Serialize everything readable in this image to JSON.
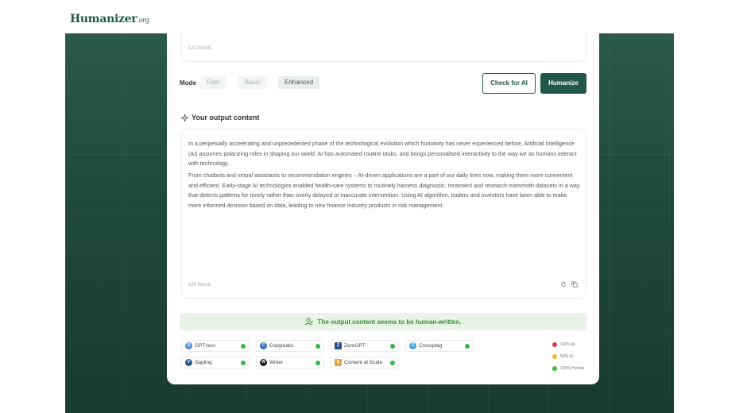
{
  "brand": {
    "name": "Humanizer",
    "suffix": ".org"
  },
  "input": {
    "word_count": "122 Words"
  },
  "mode": {
    "label": "Mode",
    "options": [
      "Fast",
      "Basic",
      "Enhanced"
    ],
    "selected": "Enhanced"
  },
  "actions": {
    "check_label": "Check for AI",
    "humanize_label": "Humanize"
  },
  "output": {
    "title": "Your output content",
    "paragraphs": [
      "In a perpetually accelerating and unprecedented phase of the technological evolution which humanity has never experienced before, Artificial Intelligence (AI) assumes polarizing roles in shaping our world. AI has automated routine tasks, and brings personalised interactivity to the way we as humans interact with technology.",
      "From chatbots and virtual assistants to recommendation engines – AI-driven applications are a part of our daily lives now, making them more convenient and efficient. Early-stage AI technologies enabled health-care systems to routinely harness diagnostic, treatment and research mammoth datasets in a way that detects patterns for timely rather than overly delayed or inaccurate intervention. Using AI algorithm, traders and investors have been able to make more informed decision based on data, leading to new finance industry products in risk management."
    ],
    "word_count": "129 Words",
    "icons": [
      "refresh-icon",
      "copy-icon"
    ]
  },
  "result": {
    "message": "The output content seems to be human-written.",
    "icon": "user-check-icon",
    "color": "#3d8a37"
  },
  "detectors": [
    {
      "name": "GPTzero",
      "logo": "G",
      "logo_color": "#5b8fd6",
      "status_color": "#3bb54a"
    },
    {
      "name": "Copyleaks",
      "logo": "C",
      "logo_color": "#3b6fb0",
      "status_color": "#3bb54a"
    },
    {
      "name": "ZeroGPT",
      "logo": "Z",
      "logo_color": "#2d4e86",
      "status_color": "#3bb54a"
    },
    {
      "name": "Crossplag",
      "logo": "C",
      "logo_color": "#4aa3df",
      "status_color": "#3bb54a"
    },
    {
      "name": "Sapling",
      "logo": "V",
      "logo_color": "#2d5c8a",
      "status_color": "#3bb54a"
    },
    {
      "name": "Writer",
      "logo": "W",
      "logo_color": "#222222",
      "status_color": "#3bb54a"
    },
    {
      "name": "Content at Scale",
      "logo": "S",
      "logo_color": "#e6a23c",
      "status_color": "#3bb54a"
    }
  ],
  "legend": [
    {
      "label": "100% AI",
      "color": "#e03b3b"
    },
    {
      "label": "50% AI",
      "color": "#f2b71e"
    },
    {
      "label": "100% Human",
      "color": "#3bb54a"
    }
  ]
}
